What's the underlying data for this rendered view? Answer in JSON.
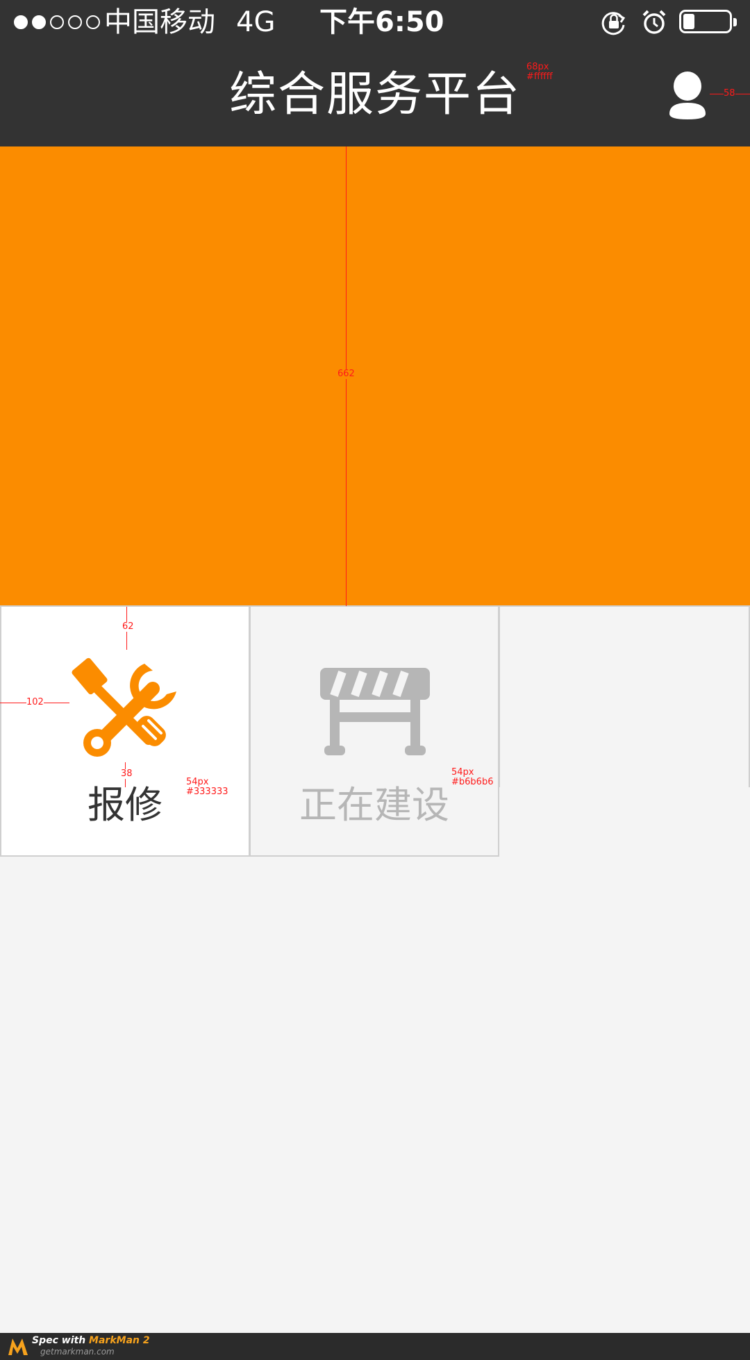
{
  "status_bar": {
    "carrier": "中国移动",
    "network": "4G",
    "time": "下午6:50",
    "signal_bars_filled": 2,
    "signal_bars_total": 5,
    "icons": [
      "rotation-lock-icon",
      "alarm-icon",
      "battery-icon"
    ]
  },
  "header": {
    "title": "综合服务平台",
    "user_icon": "user-icon"
  },
  "colors": {
    "header_bg": "#333333",
    "banner": "#fb8c00",
    "repair_icon": "#fb8c00",
    "construction_icon": "#b6b6b6",
    "label_active": "#333333",
    "label_inactive": "#b6b6b6"
  },
  "tiles": [
    {
      "label": "报修",
      "icon": "wrench-screwdriver-icon"
    },
    {
      "label": "正在建设",
      "icon": "road-barrier-icon"
    }
  ],
  "annotations": {
    "title_spec_size": "68px",
    "title_spec_color": "#ffffff",
    "user_margin": "58",
    "banner_height": "662",
    "tile_top_gap": "62",
    "tile_left_gap": "102",
    "icon_label_gap": "38",
    "repair_label_size": "54px",
    "repair_label_color": "#333333",
    "construction_label_size": "54px",
    "construction_label_color": "#b6b6b6"
  },
  "footer": {
    "brand_prefix": "Spec with ",
    "brand_name": "MarkMan 2",
    "site": "getmarkman.com"
  }
}
